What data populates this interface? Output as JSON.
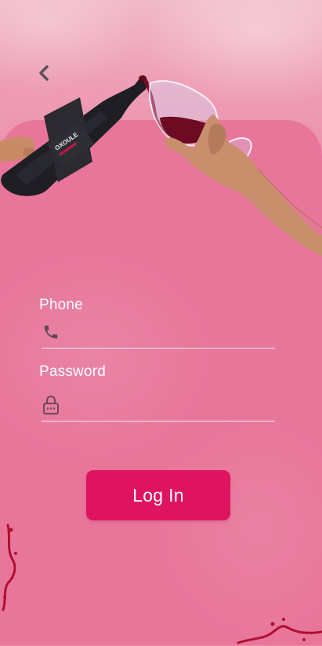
{
  "nav": {
    "back_icon": "chevron-left-icon"
  },
  "hero": {
    "bottom_label": "OXOULE"
  },
  "form": {
    "phone": {
      "label": "Phone",
      "value": "",
      "placeholder": "",
      "icon": "phone-icon"
    },
    "password": {
      "label": "Password",
      "value": "",
      "placeholder": "",
      "icon": "lock-icon"
    }
  },
  "actions": {
    "login_label": "Log In"
  },
  "colors": {
    "background": "#e8769b",
    "accent": "#df1460",
    "wine": "#8c0a2a",
    "text": "#ffffff"
  }
}
